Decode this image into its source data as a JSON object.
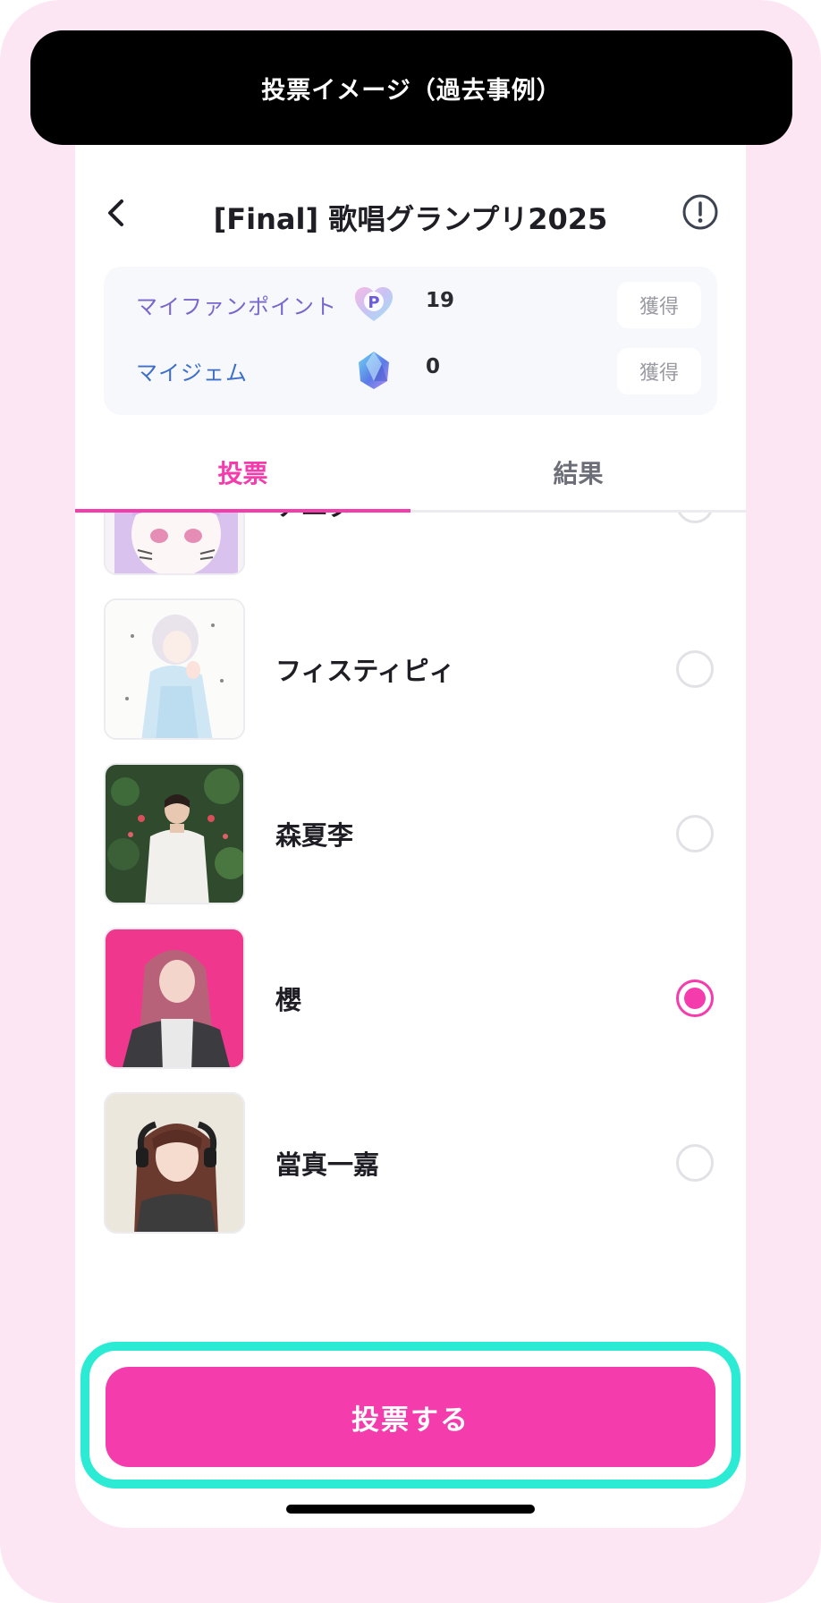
{
  "banner": {
    "text": "投票イメージ（過去事例）"
  },
  "header": {
    "title": "[Final] 歌唱グランプリ2025"
  },
  "points": {
    "fan_points": {
      "label": "マイファンポイント",
      "value": "19",
      "button": "獲得"
    },
    "gems": {
      "label": "マイジェム",
      "value": "0",
      "button": "獲得"
    }
  },
  "tabs": [
    {
      "label": "投票",
      "active": true
    },
    {
      "label": "結果",
      "active": false
    }
  ],
  "candidates": [
    {
      "name": "ナユタ",
      "selected": false
    },
    {
      "name": "フィスティピィ",
      "selected": false
    },
    {
      "name": "森夏李",
      "selected": false
    },
    {
      "name": "櫻",
      "selected": true
    },
    {
      "name": "當真一嘉",
      "selected": false
    }
  ],
  "action": {
    "vote_button": "投票する"
  },
  "colors": {
    "accent": "#f53cac",
    "highlight": "#2cebd4",
    "background": "#fde6f3"
  }
}
